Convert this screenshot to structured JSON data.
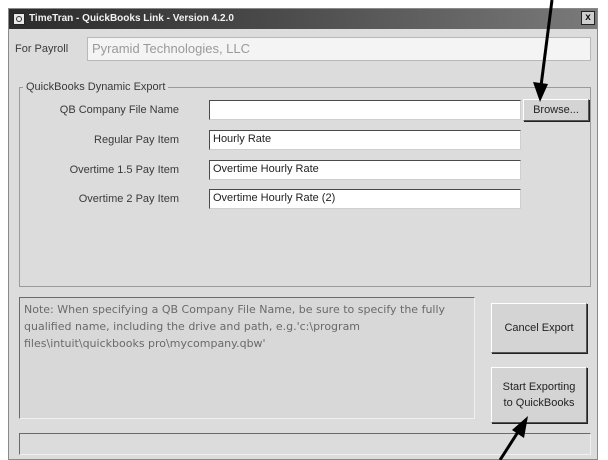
{
  "window": {
    "title": "TimeTran - QuickBooks Link - Version 4.2.0",
    "close_glyph": "x"
  },
  "payroll": {
    "label": "For Payroll",
    "value": "Pyramid Technologies, LLC"
  },
  "export_group": {
    "legend": "QuickBooks Dynamic Export",
    "fields": [
      {
        "label": "QB Company File Name",
        "value": ""
      },
      {
        "label": "Regular Pay Item",
        "value": "Hourly Rate"
      },
      {
        "label": "Overtime 1.5 Pay Item",
        "value": "Overtime Hourly Rate"
      },
      {
        "label": "Overtime 2 Pay Item",
        "value": "Overtime Hourly Rate (2)"
      }
    ],
    "browse_label": "Browse..."
  },
  "note": {
    "text": "Note: When specifying a QB Company File Name, be sure to specify the fully qualified name, including the drive and path, e.g.'c:\\program files\\intuit\\quickbooks pro\\mycompany.qbw'"
  },
  "buttons": {
    "cancel_label": "Cancel Export",
    "start_label": "Start Exporting to QuickBooks"
  },
  "status_bar": {
    "text": ""
  },
  "colors": {
    "window_bg": "#dcdcdc",
    "titlebar": "#2b2b2b",
    "annotation_arrow": "#000000"
  },
  "icons": [
    "app-icon",
    "close-icon",
    "annotation-arrow"
  ]
}
